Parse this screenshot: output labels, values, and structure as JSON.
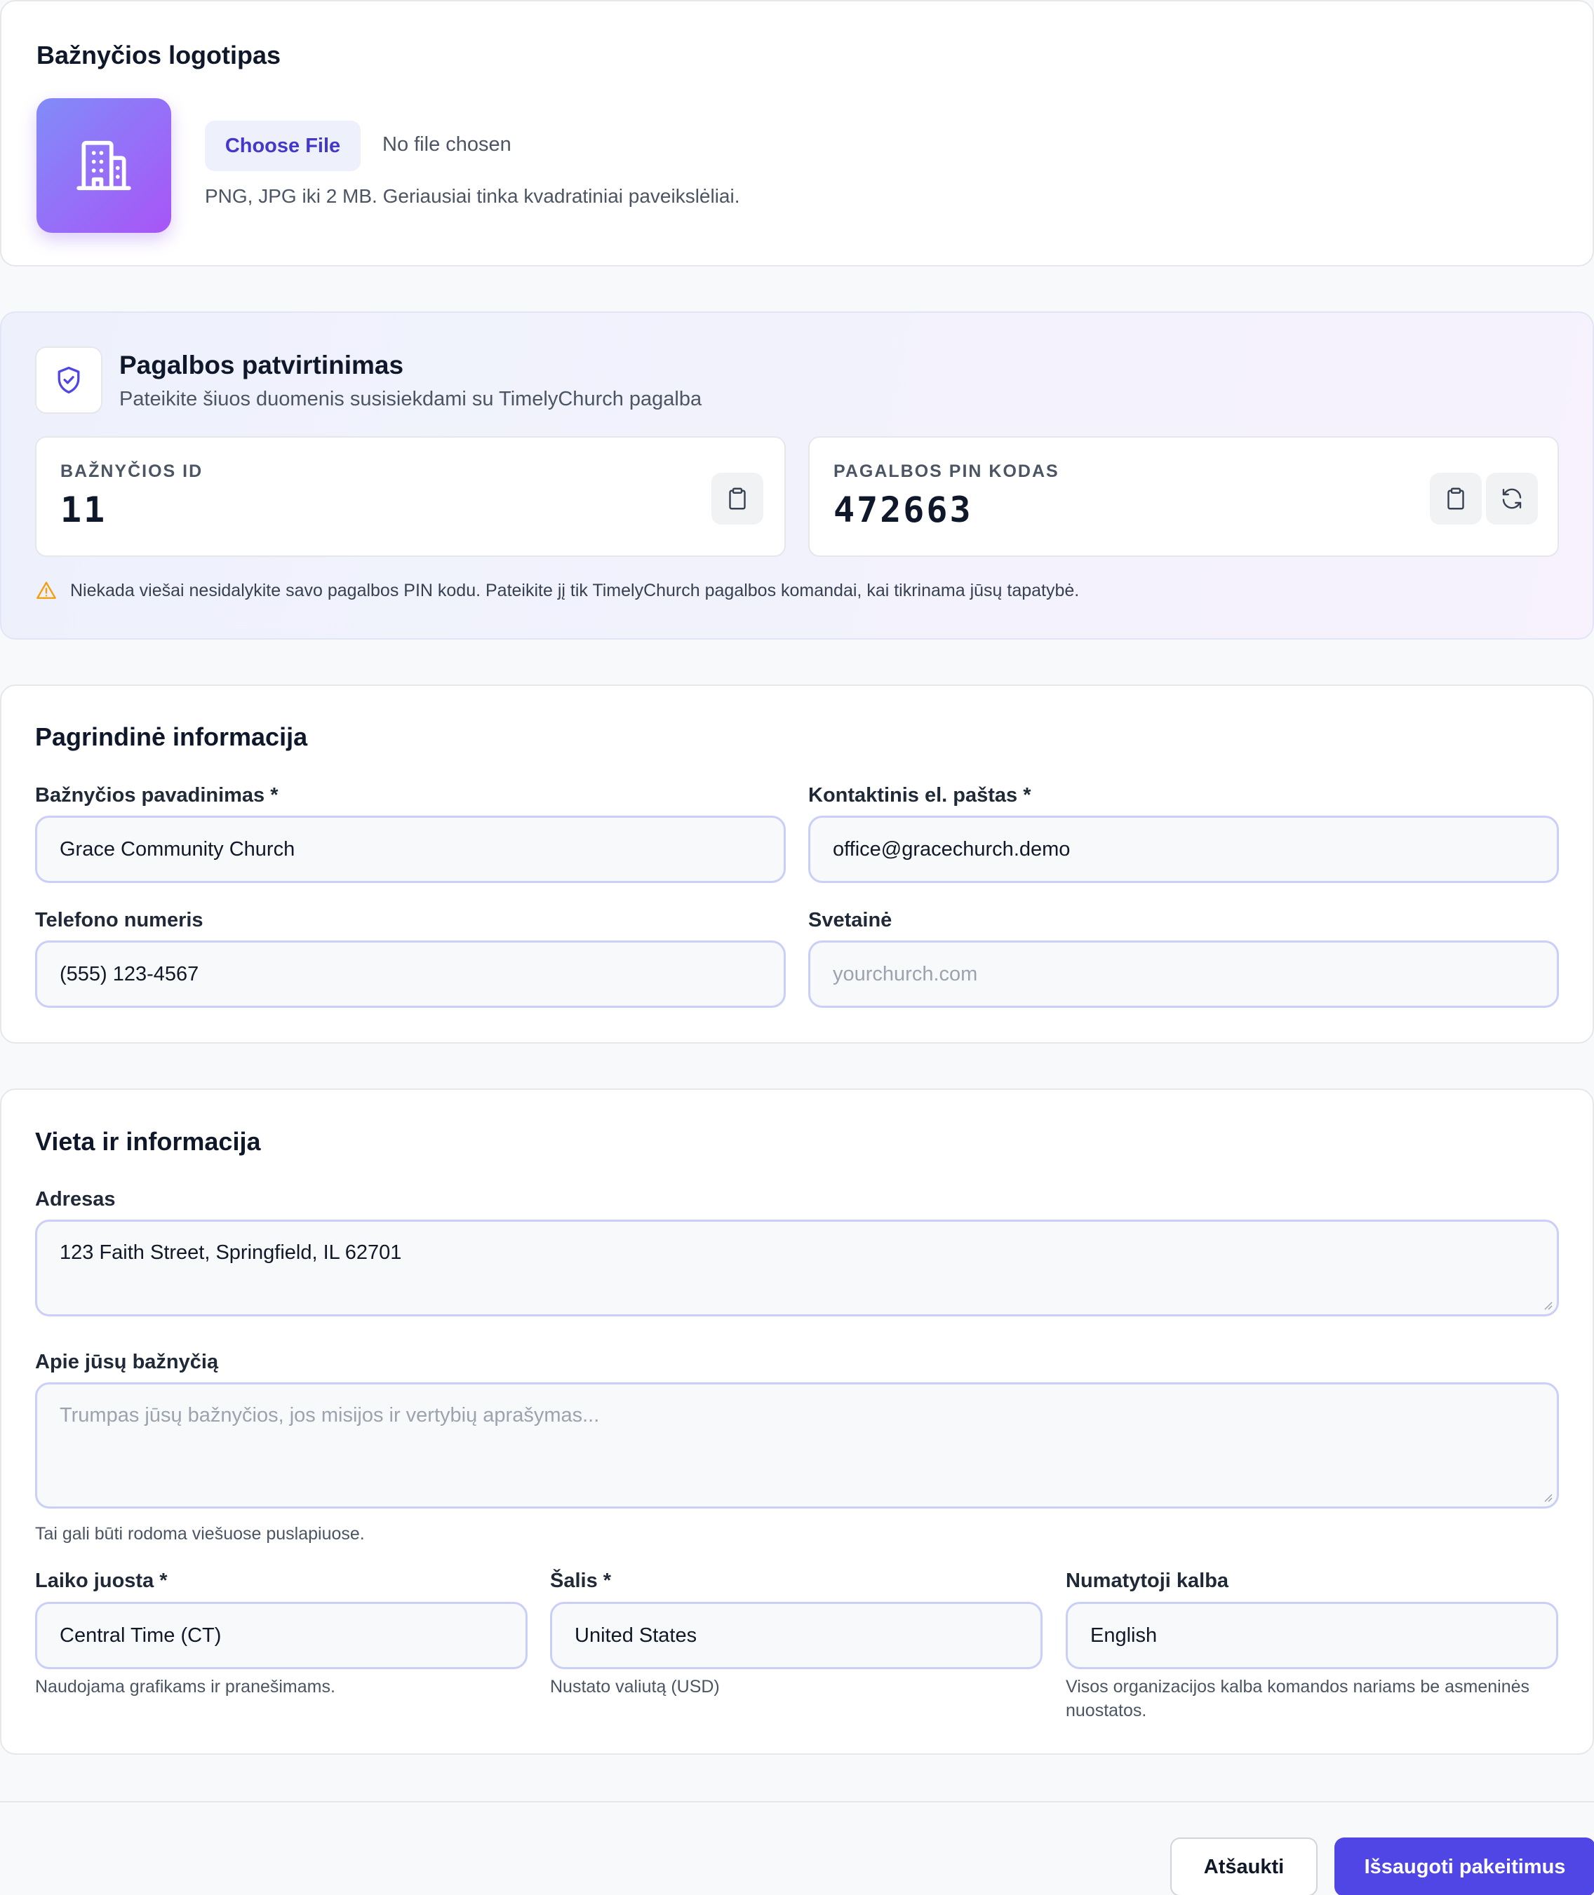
{
  "logo_section": {
    "title": "Bažnyčios logotipas",
    "choose_file_label": "Choose File",
    "file_status": "No file chosen",
    "hint": "PNG, JPG iki 2 MB. Geriausiai tinka kvadratiniai paveikslėliai.",
    "icon": "building-icon"
  },
  "support": {
    "title": "Pagalbos patvirtinimas",
    "subtitle": "Pateikite šiuos duomenis susisiekdami su TimelyChurch pagalba",
    "church_id_label": "BAŽNYČIOS ID",
    "church_id_value": "11",
    "pin_label": "PAGALBOS PIN KODAS",
    "pin_value": "472663",
    "warning": "Niekada viešai nesidalykite savo pagalbos PIN kodu. Pateikite jį tik TimelyChurch pagalbos komandai, kai tikrinama jūsų tapatybė.",
    "icons": [
      "shield-check-icon",
      "clipboard-icon",
      "refresh-icon",
      "warning-icon"
    ]
  },
  "basic_info": {
    "title": "Pagrindinė informacija",
    "church_name_label": "Bažnyčios pavadinimas *",
    "church_name_value": "Grace Community Church",
    "email_label": "Kontaktinis el. paštas *",
    "email_value": "office@gracechurch.demo",
    "phone_label": "Telefono numeris",
    "phone_value": "(555) 123-4567",
    "website_label": "Svetainė",
    "website_placeholder": "yourchurch.com"
  },
  "location": {
    "title": "Vieta ir informacija",
    "address_label": "Adresas",
    "address_value": "123 Faith Street, Springfield, IL 62701",
    "about_label": "Apie jūsų bažnyčią",
    "about_placeholder": "Trumpas jūsų bažnyčios, jos misijos ir vertybių aprašymas...",
    "about_help": "Tai gali būti rodoma viešuose puslapiuose.",
    "timezone_label": "Laiko juosta *",
    "timezone_value": "Central Time (CT)",
    "timezone_help": "Naudojama grafikams ir pranešimams.",
    "country_label": "Šalis *",
    "country_value": "United States",
    "country_help": "Nustato valiutą (USD)",
    "language_label": "Numatytoji kalba",
    "language_value": "English",
    "language_help": "Visos organizacijos kalba komandos nariams be asmeninės nuostatos."
  },
  "footer": {
    "cancel_label": "Atšaukti",
    "save_label": "Išsaugoti pakeitimus"
  },
  "colors": {
    "accent": "#4f46e5",
    "input_border": "#c9cff6",
    "warning": "#f59e0b"
  }
}
